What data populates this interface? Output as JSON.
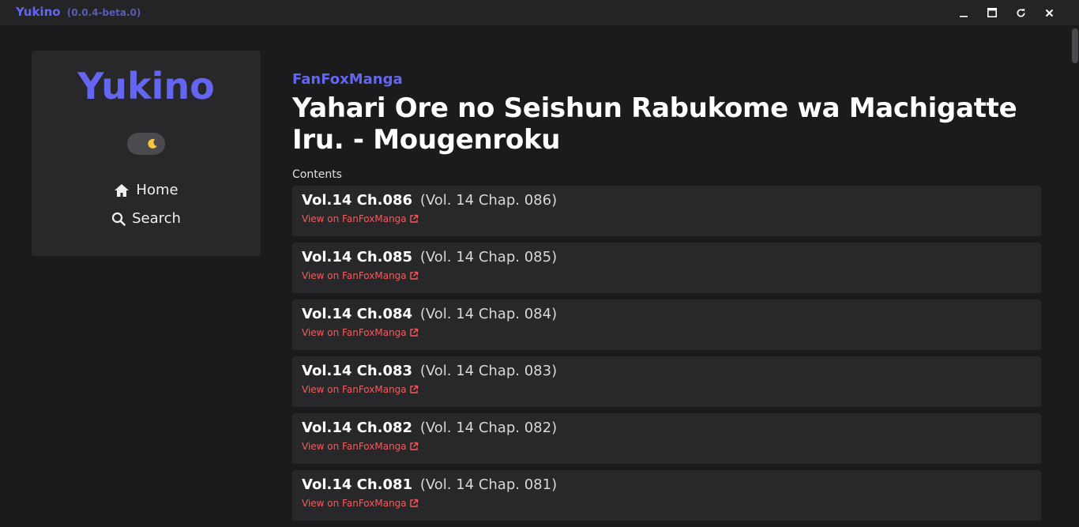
{
  "window": {
    "app_name": "Yukino",
    "version": "(0.0.4-beta.0)"
  },
  "sidebar": {
    "brand": "Yukino",
    "theme_toggle_icon": "moon-icon",
    "nav": [
      {
        "label": "Home",
        "icon": "home-icon"
      },
      {
        "label": "Search",
        "icon": "search-icon"
      }
    ]
  },
  "main": {
    "source": "FanFoxManga",
    "title": "Yahari Ore no Seishun Rabukome wa Machigatte Iru. - Mougenroku",
    "contents_label": "Contents",
    "chapters": [
      {
        "name": "Vol.14 Ch.086",
        "sub": "(Vol. 14 Chap. 086)",
        "link": "View on FanFoxManga"
      },
      {
        "name": "Vol.14 Ch.085",
        "sub": "(Vol. 14 Chap. 085)",
        "link": "View on FanFoxManga"
      },
      {
        "name": "Vol.14 Ch.084",
        "sub": "(Vol. 14 Chap. 084)",
        "link": "View on FanFoxManga"
      },
      {
        "name": "Vol.14 Ch.083",
        "sub": "(Vol. 14 Chap. 083)",
        "link": "View on FanFoxManga"
      },
      {
        "name": "Vol.14 Ch.082",
        "sub": "(Vol. 14 Chap. 082)",
        "link": "View on FanFoxManga"
      },
      {
        "name": "Vol.14 Ch.081",
        "sub": "(Vol. 14 Chap. 081)",
        "link": "View on FanFoxManga"
      }
    ]
  },
  "colors": {
    "accent": "#6366f1",
    "link": "#f25c5c",
    "background": "#1b1a1d",
    "card": "#28272a"
  }
}
